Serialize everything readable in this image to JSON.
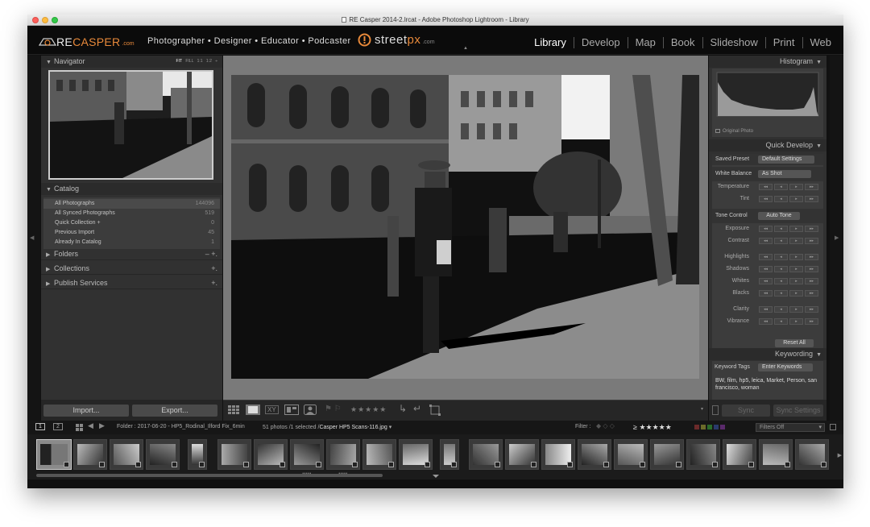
{
  "window": {
    "title": "RE Casper 2014-2.lrcat - Adobe Photoshop Lightroom - Library"
  },
  "identity": {
    "logo_re": "RE",
    "logo_casper": "CASPER",
    "logo_domain": ".com",
    "tagline": "Photographer • Designer • Educator • Podcaster",
    "streetpx_a": "street",
    "streetpx_b": "px",
    "streetpx_domain": ".com"
  },
  "modules": [
    "Library",
    "Develop",
    "Map",
    "Book",
    "Slideshow",
    "Print",
    "Web"
  ],
  "navigator": {
    "title": "Navigator",
    "zoom": [
      "FIT",
      "FILL",
      "1:1",
      "1:2 ÷"
    ]
  },
  "catalog": {
    "title": "Catalog",
    "items": [
      {
        "label": "All Photographs",
        "count": "144096"
      },
      {
        "label": "All Synced Photographs",
        "count": "519"
      },
      {
        "label": "Quick Collection +",
        "count": "0"
      },
      {
        "label": "Previous Import",
        "count": "45"
      },
      {
        "label": "Already In Catalog",
        "count": "1"
      }
    ]
  },
  "left_sections": [
    {
      "title": "Folders",
      "actions": "– +."
    },
    {
      "title": "Collections",
      "actions": "+."
    },
    {
      "title": "Publish Services",
      "actions": "+."
    }
  ],
  "left_buttons": {
    "import": "Import...",
    "export": "Export..."
  },
  "histogram": {
    "title": "Histogram",
    "original": "Original Photo"
  },
  "quick_develop": {
    "title": "Quick Develop",
    "saved_preset_label": "Saved Preset",
    "saved_preset_value": "Default Settings",
    "white_balance_label": "White Balance",
    "white_balance_value": "As Shot",
    "wb_rows": [
      "Temperature",
      "Tint"
    ],
    "tone_label": "Tone Control",
    "tone_value": "Auto Tone",
    "tone_rows": [
      "Exposure",
      "Contrast"
    ],
    "tone_rows2": [
      "Highlights",
      "Shadows",
      "Whites",
      "Blacks"
    ],
    "presence_rows": [
      "Clarity",
      "Vibrance"
    ],
    "reset": "Reset All"
  },
  "keywording": {
    "title": "Keywording",
    "tags_label": "Keyword Tags",
    "tags_value": "Enter Keywords",
    "keywords": "BW, film, hp5, leica, Market, Person, san francisco, woman"
  },
  "sync": {
    "sync": "Sync",
    "sync_settings": "Sync Settings"
  },
  "toolbar": {
    "stars": "★★★★★"
  },
  "filmstrip_bar": {
    "page1": "1",
    "page2": "2",
    "folder": "Folder : 2017-06-20 - HP5_Rodinal_Ilford Fix_6min",
    "count": "51 photos /1 selected /",
    "filename": "Casper HP5 Scans-116.jpg",
    "filter_label": "Filter :",
    "rating": "≥ ★★★★★",
    "filters_off": "Filters Off"
  },
  "colors": {
    "accent": "#e8893a",
    "panel": "#313131",
    "background": "#7a7a7a"
  }
}
